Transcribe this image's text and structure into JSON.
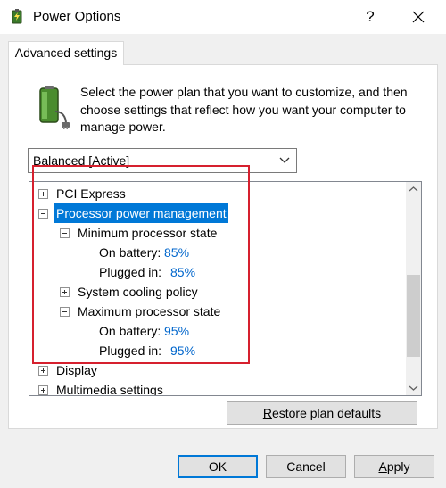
{
  "window": {
    "title": "Power Options",
    "help_label": "?",
    "icons": {
      "app": "power-options-icon",
      "close": "close-icon"
    }
  },
  "tabs": [
    {
      "label": "Advanced settings",
      "active": true
    }
  ],
  "description": "Select the power plan that you want to customize, and then choose settings that reflect how you want your computer to manage power.",
  "plan_select": {
    "value": "Balanced [Active]"
  },
  "tree": {
    "rows": [
      {
        "label": "PCI Express",
        "expander": "plus",
        "level": 0
      },
      {
        "label": "Processor power management",
        "expander": "minus",
        "level": 0,
        "selected": true
      },
      {
        "label": "Minimum processor state",
        "expander": "minus",
        "level": 1
      },
      {
        "label": "On battery:",
        "value": "85%",
        "level": 2
      },
      {
        "label": "Plugged in:",
        "value": "85%",
        "level": 2
      },
      {
        "label": "System cooling policy",
        "expander": "plus",
        "level": 1
      },
      {
        "label": "Maximum processor state",
        "expander": "minus",
        "level": 1
      },
      {
        "label": "On battery:",
        "value": "95%",
        "level": 2
      },
      {
        "label": "Plugged in:",
        "value": "95%",
        "level": 2
      },
      {
        "label": "Display",
        "expander": "plus",
        "level": 0
      },
      {
        "label": "Multimedia settings",
        "expander": "plus",
        "level": 0
      }
    ]
  },
  "buttons": {
    "restore": {
      "prefix": "R",
      "rest": "estore plan defaults"
    },
    "ok": "OK",
    "cancel": "Cancel",
    "apply": {
      "prefix": "A",
      "rest": "pply"
    }
  },
  "colors": {
    "selection": "#0078d7",
    "value_link": "#0066cc",
    "annotation_box": "#d6202e"
  }
}
